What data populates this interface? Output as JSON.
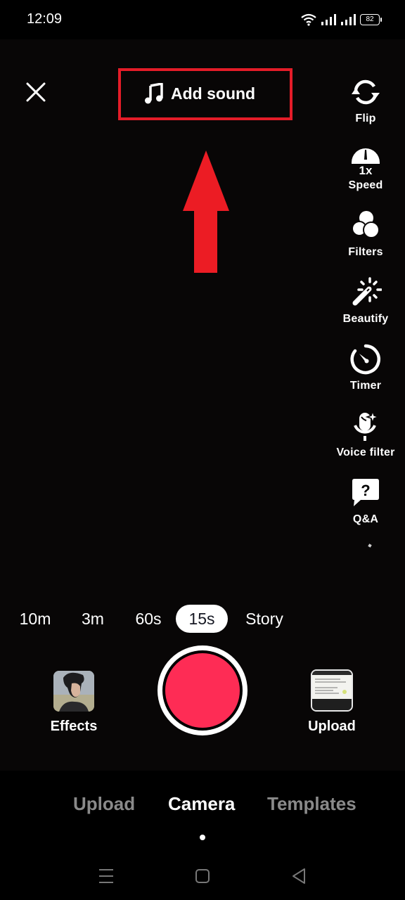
{
  "status_bar": {
    "time": "12:09",
    "battery": "82",
    "icons": [
      "wifi-icon",
      "signal-icon",
      "signal-icon",
      "battery-icon"
    ]
  },
  "top_bar": {
    "close_icon": "close-icon",
    "add_sound_label": "Add sound",
    "add_sound_icon": "music-note-icon",
    "highlight_color": "#e41c28"
  },
  "annotation": {
    "arrow_color": "#ec1c24",
    "arrow_direction": "up"
  },
  "side_tools": [
    {
      "label": "Flip",
      "icon": "flip-camera-icon"
    },
    {
      "label": "Speed",
      "icon": "speed-gauge-icon",
      "badge": "1x"
    },
    {
      "label": "Filters",
      "icon": "filters-icon"
    },
    {
      "label": "Beautify",
      "icon": "magic-wand-icon"
    },
    {
      "label": "Timer",
      "icon": "timer-icon"
    },
    {
      "label": "Voice filter",
      "icon": "voice-filter-icon"
    },
    {
      "label": "Q&A",
      "icon": "qa-icon",
      "glyph": "?"
    }
  ],
  "durations": {
    "options": [
      "10m",
      "3m",
      "60s",
      "15s",
      "Story"
    ],
    "selected": "15s"
  },
  "capture_row": {
    "effects_label": "Effects",
    "upload_label": "Upload",
    "record_color": "#fe2c55"
  },
  "bottom_tabs": {
    "items": [
      "Upload",
      "Camera",
      "Templates"
    ],
    "active": "Camera"
  },
  "nav_bar": {
    "buttons": [
      "menu-icon",
      "home-icon",
      "back-icon"
    ]
  }
}
